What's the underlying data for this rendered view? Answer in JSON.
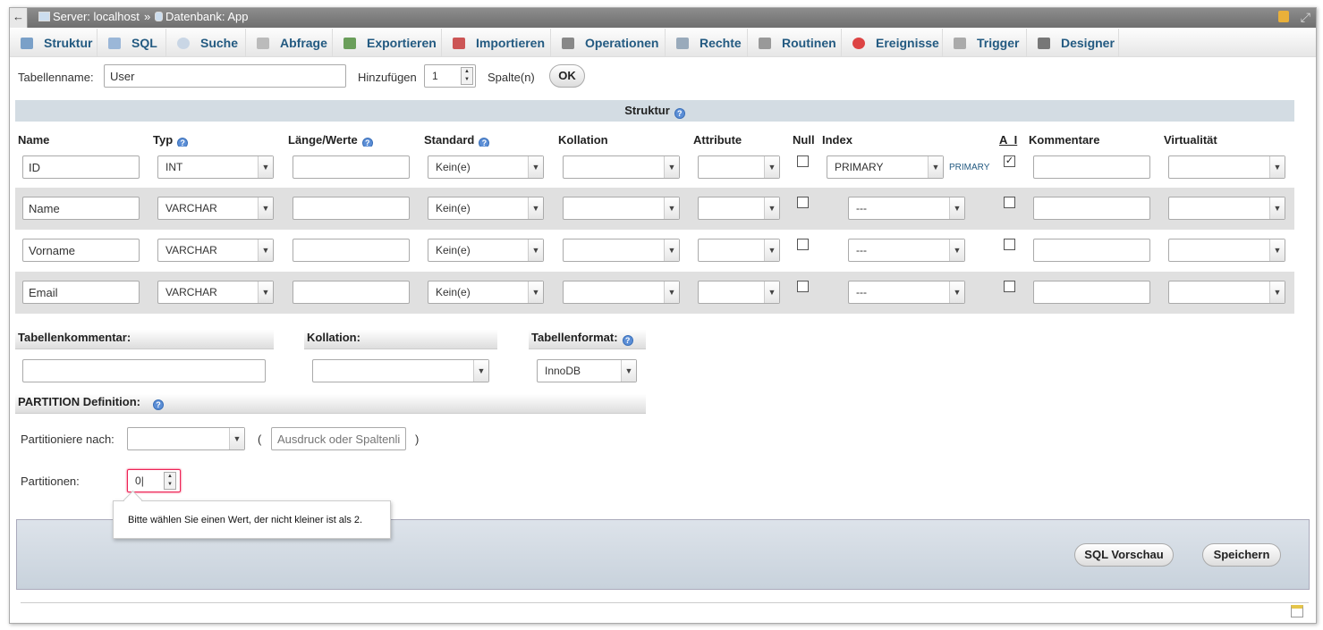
{
  "breadcrumb": {
    "server": "Server: localhost",
    "sep": "»",
    "database": "Datenbank: App"
  },
  "tabs": [
    "Struktur",
    "SQL",
    "Suche",
    "Abfrage",
    "Exportieren",
    "Importieren",
    "Operationen",
    "Rechte",
    "Routinen",
    "Ereignisse",
    "Trigger",
    "Designer"
  ],
  "form": {
    "table_name_label": "Tabellenname:",
    "table_name": "User",
    "add_label": "Hinzufügen",
    "add_count": "1",
    "columns_label": "Spalte(n)",
    "ok": "OK"
  },
  "structure_title": "Struktur",
  "headers": [
    "Name",
    "Typ",
    "Länge/Werte",
    "Standard",
    "Kollation",
    "Attribute",
    "Null",
    "Index",
    "A_I",
    "Kommentare",
    "Virtualität"
  ],
  "rows": [
    {
      "name": "ID",
      "type": "INT",
      "default": "Kein(e)",
      "index": "PRIMARY",
      "index_tag": "PRIMARY",
      "ai": true
    },
    {
      "name": "Name",
      "type": "VARCHAR",
      "default": "Kein(e)",
      "index": "---",
      "index_tag": "",
      "ai": false
    },
    {
      "name": "Vorname",
      "type": "VARCHAR",
      "default": "Kein(e)",
      "index": "---",
      "index_tag": "",
      "ai": false
    },
    {
      "name": "Email",
      "type": "VARCHAR",
      "default": "Kein(e)",
      "index": "---",
      "index_tag": "",
      "ai": false
    }
  ],
  "table_options": {
    "comment_label": "Tabellenkommentar:",
    "collation_label": "Kollation:",
    "format_label": "Tabellenformat:",
    "format_value": "InnoDB"
  },
  "partition": {
    "title": "PARTITION Definition:",
    "by_label": "Partitioniere nach:",
    "expr_placeholder": "Ausdruck oder Spaltenlis",
    "paren_open": "(",
    "paren_close": ")",
    "count_label": "Partitionen:",
    "count_value": "0",
    "tooltip": "Bitte wählen Sie einen Wert, der nicht kleiner ist als 2."
  },
  "buttons": {
    "preview": "SQL Vorschau",
    "save": "Speichern"
  },
  "colors": {
    "tab_text": "#235a81",
    "header_bar": "#d3dce3",
    "row_alt": "#e0e0e0"
  }
}
